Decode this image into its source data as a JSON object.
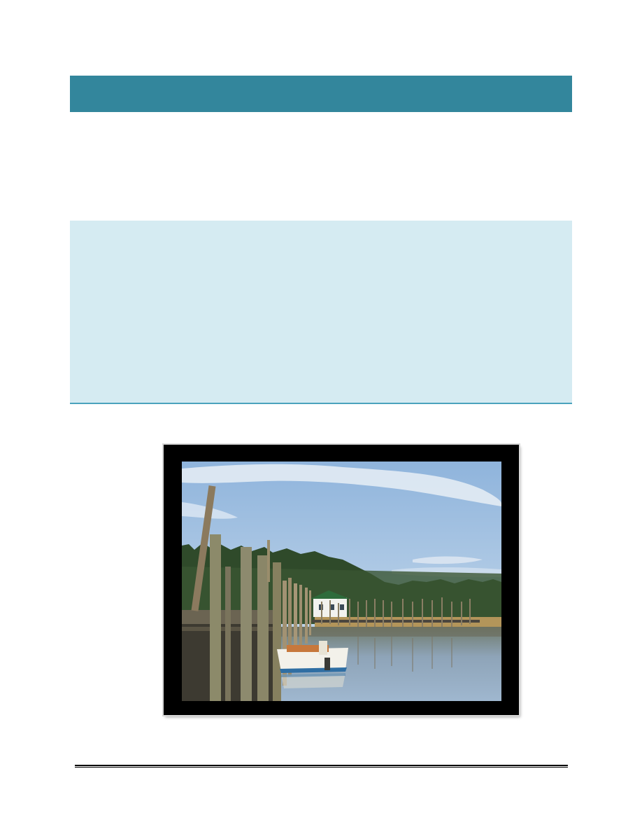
{
  "page": {
    "title_band": {
      "color": "#33869c",
      "title": ""
    },
    "info_box": {
      "color": "#d5ebf2",
      "rule_color": "#4aa3bd"
    }
  },
  "photo": {
    "subject": "",
    "frame_color": "#000000"
  },
  "footer": {
    "rule_color": "#000000"
  }
}
